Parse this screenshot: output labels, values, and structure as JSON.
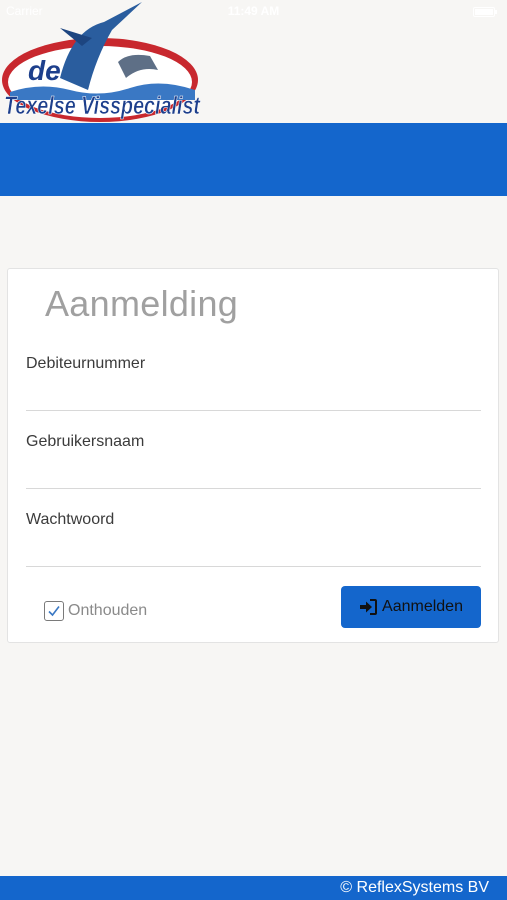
{
  "status_bar": {
    "left_text": "Carrier",
    "time": "11:49 AM"
  },
  "logo": {
    "line1": "de",
    "line2": "Texelse Visspecialist"
  },
  "login": {
    "title": "Aanmelding",
    "fields": [
      {
        "label": "Debiteurnummer",
        "value": ""
      },
      {
        "label": "Gebruikersnaam",
        "value": ""
      },
      {
        "label": "Wachtwoord",
        "value": ""
      }
    ],
    "remember_label": "Onthouden",
    "remember_checked": true,
    "submit_label": "Aanmelden",
    "submit_icon": "sign-in-icon"
  },
  "footer": {
    "text": "© ReflexSystems BV"
  },
  "colors": {
    "brand_blue": "#1466cc",
    "background": "#f7f6f4"
  }
}
